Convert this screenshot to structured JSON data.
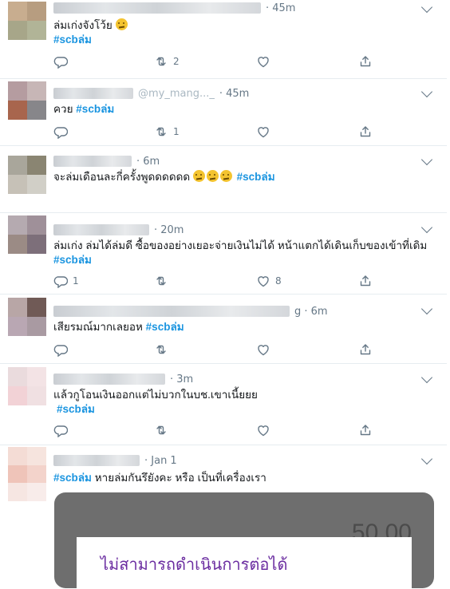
{
  "colors": {
    "accent": "#1b95e0",
    "secondary_text": "#657786",
    "divider": "#e6ecf0",
    "dialog_title": "#6a2ca0"
  },
  "tweets": [
    {
      "time": "· 45m",
      "text": "ล่มเก่งจังโว้ย",
      "hashtag": "#scbล่ม",
      "retweets": "2",
      "likes": "",
      "replies": ""
    },
    {
      "handle": "@my_mang..._",
      "time": "· 45m",
      "text": "ควย",
      "hashtag": "#scbล่ม",
      "retweets": "1",
      "likes": "",
      "replies": ""
    },
    {
      "time": "· 6m",
      "text": "จะล่มเดือนละกี่ครั้งพูดดดดดด",
      "hashtag": "#scbล่ม",
      "retweets": "",
      "likes": "",
      "replies": ""
    },
    {
      "time": "· 20m",
      "text": "ล่มเก่ง ล่มได้ล่มดี ซื้อของอย่างเยอะจ่ายเงินไม่ได้ หน้าแตกได้เดินเก็บของเข้าที่เดิม",
      "hashtag": "#scbล่ม",
      "retweets": "",
      "likes": "8",
      "replies": "1"
    },
    {
      "time": "g · 6m",
      "text": "เสียรมณ์มากเลยอห",
      "hashtag": "#scbล่ม",
      "retweets": "",
      "likes": "",
      "replies": ""
    },
    {
      "time": "· 3m",
      "text": "แล้วกูโอนเงินออกแต่ไม่บวกในบช.เขาเนี้ยยย",
      "hashtag": "#scbล่ม",
      "retweets": "",
      "likes": "",
      "replies": ""
    },
    {
      "time": "· Jan 1",
      "text": "หายล่มกันรึยังคะ หรือ เป็นที่เครื่องเรา",
      "hashtag": "#scbล่ม",
      "retweets": "",
      "likes": "",
      "replies": ""
    }
  ],
  "media": {
    "amount": "50.00",
    "dialog_title": "ไม่สามารถดำเนินการต่อได้"
  },
  "icons": {
    "reply": "reply-icon",
    "retweet": "retweet-icon",
    "like": "heart-icon",
    "share": "share-icon",
    "caret": "chevron-down-icon"
  }
}
